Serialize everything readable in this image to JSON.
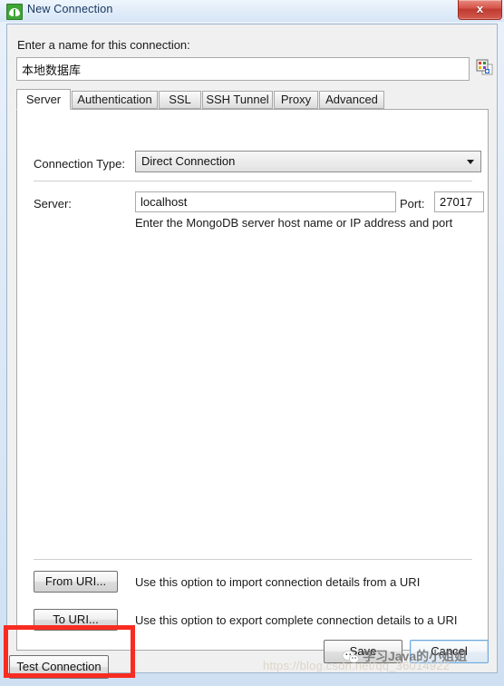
{
  "window": {
    "title": "New Connection",
    "app_icon": "mongodb-leaf-icon",
    "close_label": "x"
  },
  "form": {
    "name_label": "Enter a name for this connection:",
    "name_value": "本地数据库",
    "name_placeholder": "",
    "color_icon": "color-swatch-icon"
  },
  "tabs": [
    {
      "label": "Server",
      "active": true
    },
    {
      "label": "Authentication",
      "active": false
    },
    {
      "label": "SSL",
      "active": false
    },
    {
      "label": "SSH Tunnel",
      "active": false
    },
    {
      "label": "Proxy",
      "active": false
    },
    {
      "label": "Advanced",
      "active": false
    }
  ],
  "server_tab": {
    "connection_type_label": "Connection Type:",
    "connection_type_value": "Direct Connection",
    "connection_type_options": [
      "Direct Connection"
    ],
    "server_label": "Server:",
    "server_value": "localhost",
    "port_label": "Port:",
    "port_value": "27017",
    "hint": "Enter the MongoDB server host name or IP address and port",
    "from_uri_button": "From URI...",
    "from_uri_desc": "Use this option to import connection details from a URI",
    "to_uri_button": "To URI...",
    "to_uri_desc": "Use this option to export complete connection details to a URI"
  },
  "actions": {
    "test_connection": "Test Connection",
    "save": "Save",
    "cancel": "Cancel"
  },
  "annotation": {
    "highlight_color": "#f82c21",
    "target": "test-connection-button"
  },
  "watermark": {
    "url": "https://blog.csdn.net/qq_36014922",
    "author": "学习Java的小姐姐",
    "logo": "wechat-icon"
  }
}
